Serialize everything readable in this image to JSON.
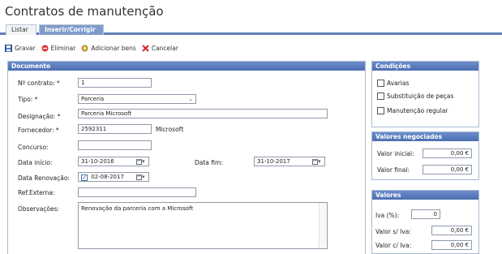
{
  "page": {
    "title": "Contratos de manutenção"
  },
  "tabs": [
    {
      "label": "Listar"
    },
    {
      "label": "Inserir/Corrigir"
    }
  ],
  "toolbar": {
    "gravar": "Gravar",
    "eliminar": "Eliminar",
    "adicionar": "Adicionar bens",
    "cancelar": "Cancelar"
  },
  "documento": {
    "header": "Documento",
    "contrato_label": "Nº contrato: *",
    "contrato_value": "1",
    "tipo_label": "Tipo: *",
    "tipo_value": "Parceria",
    "designacao_label": "Designação: *",
    "designacao_value": "Parceria Microsoft",
    "fornecedor_label": "Fornecedor: *",
    "fornecedor_value": "2592311",
    "fornecedor_name": "Microsoft",
    "concurso_label": "Concurso:",
    "concurso_value": "",
    "data_inicio_label": "Data início:",
    "data_inicio_value": "31-10-2016",
    "data_fim_label": "Data fim:",
    "data_fim_value": "31-10-2017",
    "data_renov_label": "Data Renovação:",
    "data_renov_value": "02-08-2017",
    "ref_externa_label": "Ref.Externa:",
    "ref_externa_value": "",
    "observacoes_label": "Observações:",
    "observacoes_value": "Renovação da parceria com a Microsoft"
  },
  "condicoes": {
    "header": "Condições",
    "items": [
      "Avarias",
      "Substituição de peças",
      "Manutenção regular"
    ]
  },
  "valores_negociados": {
    "header": "Valores negociados",
    "inicial_label": "Valor inicial:",
    "inicial_value": "0,00 €",
    "final_label": "Valor final:",
    "final_value": "0,00 €"
  },
  "valores": {
    "header": "Valores",
    "iva_label": "Iva (%):",
    "iva_value": "0",
    "sem_iva_label": "Valor s/ Iva:",
    "sem_iva_value": "0,00 €",
    "com_iva_label": "Valor c/ Iva:",
    "com_iva_value": "0,00 €"
  }
}
